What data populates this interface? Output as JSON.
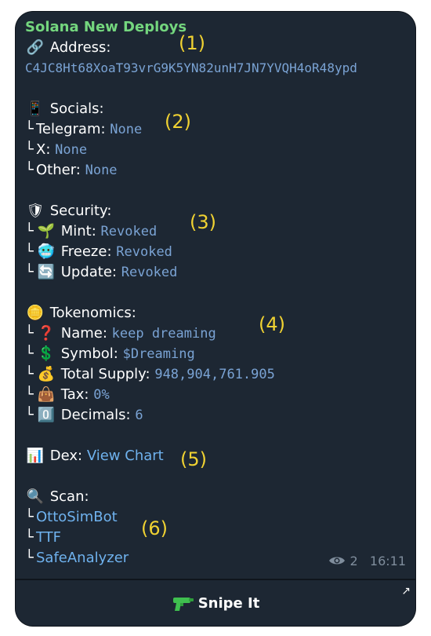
{
  "message": {
    "title": "Solana New Deploys",
    "address_label": "Address:",
    "address": "C4JC8Ht68XoaT93vrG9K5YN82unH7JN7YVQH4oR48ypd",
    "socials_label": "Socials:",
    "telegram_label": "Telegram:",
    "telegram_value": "None",
    "x_label": "X:",
    "x_value": "None",
    "other_label": "Other:",
    "other_value": "None",
    "security_label": "Security:",
    "mint_label": "Mint:",
    "mint_value": "Revoked",
    "freeze_label": "Freeze:",
    "freeze_value": "Revoked",
    "update_label": "Update:",
    "update_value": "Revoked",
    "tokenomics_label": "Tokenomics:",
    "name_label": "Name:",
    "name_value": "keep dreaming",
    "symbol_label": "Symbol:",
    "symbol_value": "$Dreaming",
    "supply_label": "Total Supply:",
    "supply_value": "948,904,761.905",
    "tax_label": "Tax:",
    "tax_value": "0%",
    "decimals_label": "Decimals:",
    "decimals_value": "6",
    "dex_label": "Dex:",
    "dex_link": "View Chart",
    "scan_label": "Scan:",
    "scan_links": [
      "OttoSimBot",
      "TTF",
      "SafeAnalyzer"
    ],
    "views": "2",
    "time": "16:11"
  },
  "markers": [
    "(1)",
    "(2)",
    "(3)",
    "(4)",
    "(5)",
    "(6)"
  ],
  "button": {
    "label": "Snipe It"
  },
  "colors": {
    "title": "#74d67e",
    "mono": "#7aa3d4",
    "link": "#6fb2ee",
    "marker": "#f0d232",
    "bubble": "#1d2733"
  }
}
